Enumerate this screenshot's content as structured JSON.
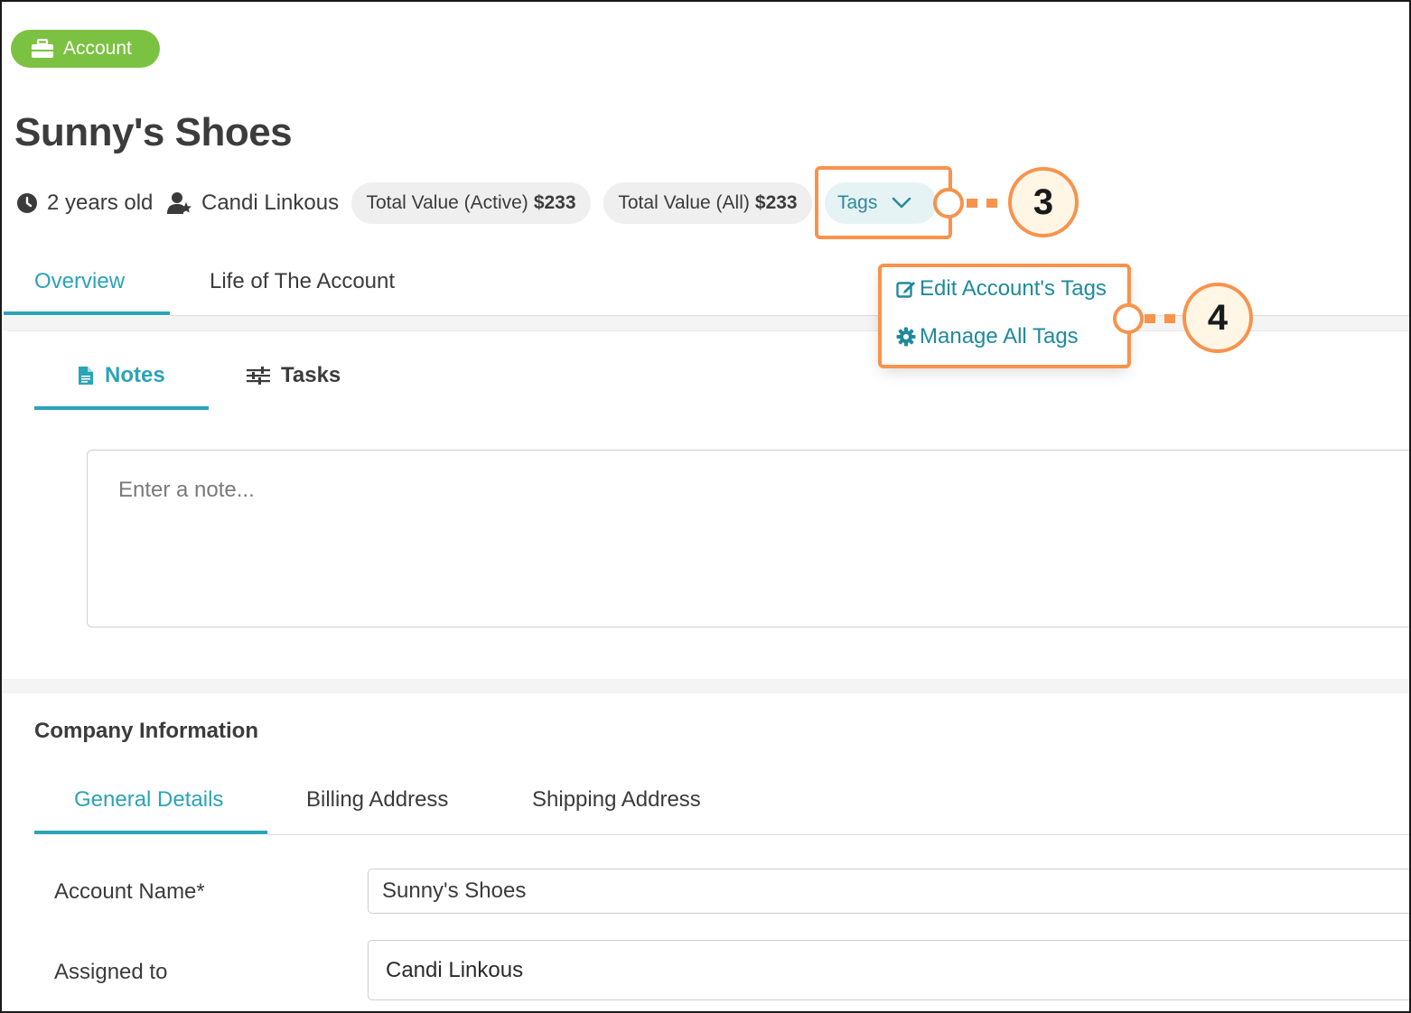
{
  "header": {
    "badge_label": "Account",
    "title": "Sunny's Shoes"
  },
  "meta": {
    "age": "2 years old",
    "owner": "Candi Linkous",
    "total_active_label": "Total Value (Active)",
    "total_active_value": "$233",
    "total_all_label": "Total Value (All)",
    "total_all_value": "$233",
    "tags_label": "Tags"
  },
  "tags_menu": {
    "edit_label": "Edit Account's Tags",
    "manage_label": "Manage All Tags"
  },
  "callouts": {
    "tags": "3",
    "menu": "4"
  },
  "main_tabs": [
    "Overview",
    "Life of The Account"
  ],
  "activity_tabs": [
    "Notes",
    "Tasks"
  ],
  "notes": {
    "placeholder": "Enter a note..."
  },
  "company": {
    "heading": "Company Information",
    "tabs": [
      "General Details",
      "Billing Address",
      "Shipping Address"
    ],
    "account_name_label": "Account Name*",
    "account_name_value": "Sunny's Shoes",
    "assigned_label": "Assigned to",
    "assigned_value": "Candi Linkous"
  },
  "colors": {
    "badge_green": "#7cc242",
    "accent_teal": "#2ba3b8",
    "callout_orange": "#f7934d"
  }
}
